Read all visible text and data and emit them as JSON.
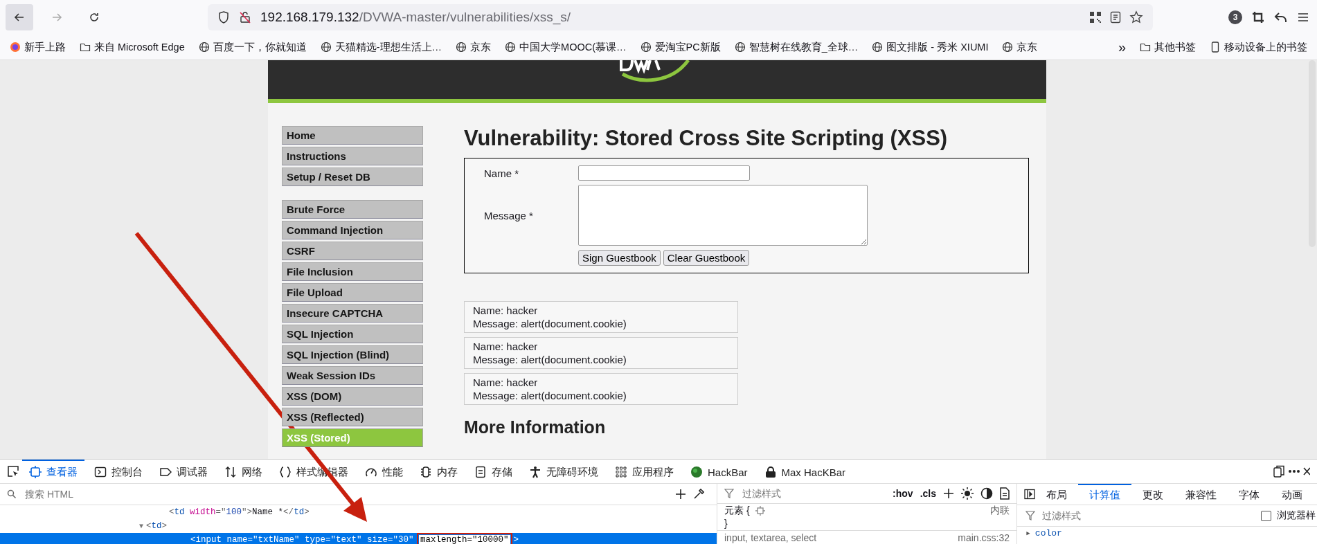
{
  "browser": {
    "address": {
      "host": "192.168.179.132",
      "path": "/DVWA-master/vulnerabilities/xss_s/"
    },
    "tab_count": "3",
    "bookmarks": [
      {
        "label": "新手上路",
        "kind": "firefox"
      },
      {
        "label": "来自 Microsoft Edge",
        "kind": "folder"
      },
      {
        "label": "百度一下，你就知道",
        "kind": "globe"
      },
      {
        "label": "天猫精选-理想生活上…",
        "kind": "globe"
      },
      {
        "label": "京东",
        "kind": "globe"
      },
      {
        "label": "中国大学MOOC(慕课…",
        "kind": "globe"
      },
      {
        "label": "爱淘宝PC新版",
        "kind": "globe"
      },
      {
        "label": "智慧树在线教育_全球…",
        "kind": "globe"
      },
      {
        "label": "图文排版 - 秀米 XIUMI",
        "kind": "globe"
      },
      {
        "label": "京东",
        "kind": "globe"
      }
    ],
    "more_bookmarks": "»",
    "other_bookmarks": [
      {
        "label": "其他书签",
        "kind": "folder"
      },
      {
        "label": "移动设备上的书签",
        "kind": "phone"
      }
    ]
  },
  "page": {
    "menu": [
      [
        {
          "label": "Home",
          "selected": false
        },
        {
          "label": "Instructions",
          "selected": false
        },
        {
          "label": "Setup / Reset DB",
          "selected": false
        }
      ],
      [
        {
          "label": "Brute Force",
          "selected": false
        },
        {
          "label": "Command Injection",
          "selected": false
        },
        {
          "label": "CSRF",
          "selected": false
        },
        {
          "label": "File Inclusion",
          "selected": false
        },
        {
          "label": "File Upload",
          "selected": false
        },
        {
          "label": "Insecure CAPTCHA",
          "selected": false
        },
        {
          "label": "SQL Injection",
          "selected": false
        },
        {
          "label": "SQL Injection (Blind)",
          "selected": false
        },
        {
          "label": "Weak Session IDs",
          "selected": false
        },
        {
          "label": "XSS (DOM)",
          "selected": false
        },
        {
          "label": "XSS (Reflected)",
          "selected": false
        },
        {
          "label": "XSS (Stored)",
          "selected": true
        }
      ]
    ],
    "title": "Vulnerability: Stored Cross Site Scripting (XSS)",
    "form": {
      "name_label": "Name *",
      "message_label": "Message *",
      "buttons": [
        "Sign Guestbook",
        "Clear Guestbook"
      ]
    },
    "entries": [
      {
        "name": "Name: hacker",
        "message": "Message: alert(document.cookie)"
      },
      {
        "name": "Name: hacker",
        "message": "Message: alert(document.cookie)"
      },
      {
        "name": "Name: hacker",
        "message": "Message: alert(document.cookie)"
      }
    ],
    "more_heading": "More Information"
  },
  "devtools": {
    "tabs": [
      {
        "label": "查看器",
        "selected": true
      },
      {
        "label": "控制台",
        "selected": false
      },
      {
        "label": "调试器",
        "selected": false
      },
      {
        "label": "网络",
        "selected": false
      },
      {
        "label": "样式编辑器",
        "selected": false
      },
      {
        "label": "性能",
        "selected": false
      },
      {
        "label": "内存",
        "selected": false
      },
      {
        "label": "存储",
        "selected": false
      },
      {
        "label": "无障碍环境",
        "selected": false
      },
      {
        "label": "应用程序",
        "selected": false
      },
      {
        "label": "HackBar",
        "selected": false
      },
      {
        "label": "Max HacKBar",
        "selected": false
      }
    ],
    "search_placeholder": "搜索 HTML",
    "lines": [
      {
        "selected": false,
        "tokens": [
          {
            "text": "<",
            "kind": "punct"
          },
          {
            "text": "td",
            "kind": "tag"
          },
          {
            "text": " width",
            "kind": "attr"
          },
          {
            "text": "=\"",
            "kind": "punct"
          },
          {
            "text": "100",
            "kind": "value"
          },
          {
            "text": "\">",
            "kind": "punct"
          },
          {
            "text": "Name *",
            "kind": "text"
          },
          {
            "text": "</",
            "kind": "punct"
          },
          {
            "text": "td",
            "kind": "tag"
          },
          {
            "text": ">",
            "kind": "punct"
          }
        ]
      },
      {
        "selected": false,
        "expander": "▼",
        "tokens": [
          {
            "text": "<",
            "kind": "punct"
          },
          {
            "text": "td",
            "kind": "tag"
          },
          {
            "text": ">",
            "kind": "punct"
          }
        ]
      },
      {
        "selected": true,
        "tokens": [
          {
            "text": "<input name=\"txtName\" type=\"text\" size=\"30\" "
          },
          {
            "text": "maxlength=\"10000\"",
            "boxed": true
          },
          {
            "text": ">"
          }
        ]
      }
    ],
    "styles": {
      "filter_placeholder": "过滤样式",
      "hov": ":hov",
      "cls": ".cls",
      "rules": [
        {
          "selector": "元素 {",
          "source": "内联",
          "close": "}"
        },
        {
          "selector": "input, textarea, select",
          "source": "main.css:32"
        }
      ]
    },
    "side_tabs": [
      {
        "label": "布局",
        "selected": false
      },
      {
        "label": "计算值",
        "selected": true
      },
      {
        "label": "更改",
        "selected": false
      },
      {
        "label": "兼容性",
        "selected": false
      },
      {
        "label": "字体",
        "selected": false
      },
      {
        "label": "动画",
        "selected": false
      }
    ],
    "computed_filter_placeholder": "过滤样式",
    "browser_styles": {
      "label": "浏览器样",
      "checked": false
    },
    "computed": [
      {
        "expander": "▸",
        "name": "color"
      }
    ]
  },
  "annotation": {
    "arrow": true
  }
}
